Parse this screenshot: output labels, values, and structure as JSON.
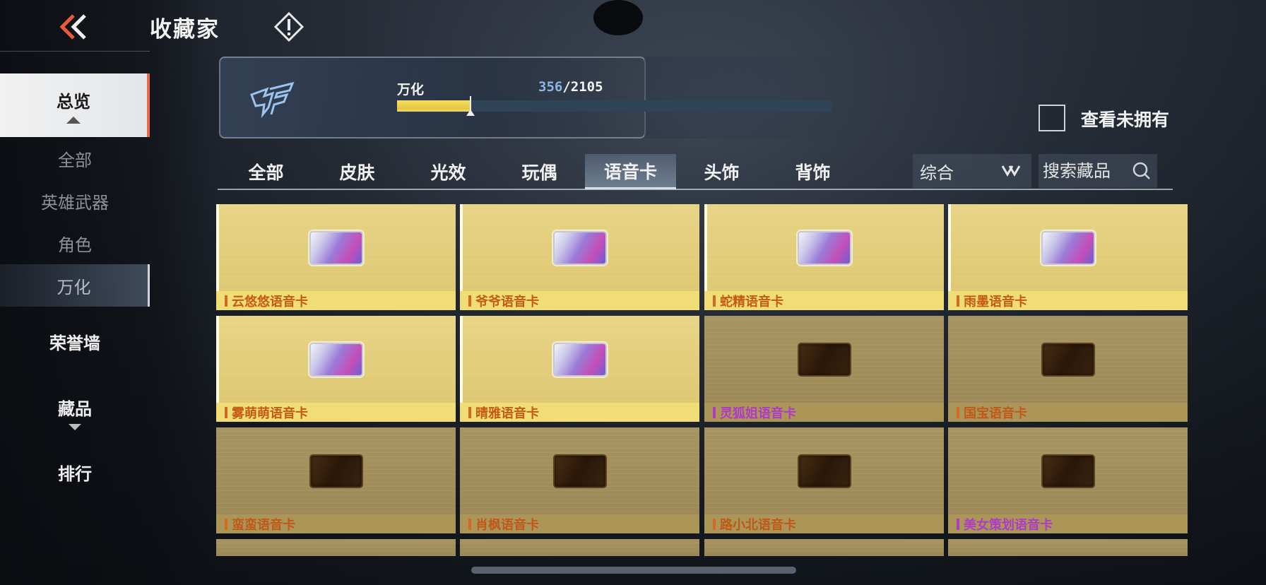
{
  "header": {
    "title": "收藏家",
    "back_icon": "double-chevron-left-icon",
    "info_icon": "exclamation-diamond-icon"
  },
  "sidebar": {
    "overview": "总览",
    "sub_items": [
      "全部",
      "英雄武器",
      "角色",
      "万化"
    ],
    "active_sub": "万化",
    "honor_wall": "荣誉墙",
    "collection": "藏品",
    "ranking": "排行"
  },
  "progress": {
    "label": "万化",
    "current": "356",
    "total": "/2105",
    "fraction": 0.169
  },
  "filter": {
    "unowned_label": "查看未拥有",
    "unowned_checked": false
  },
  "tabs": [
    "全部",
    "皮肤",
    "光效",
    "玩偶",
    "语音卡",
    "头饰",
    "背饰"
  ],
  "active_tab": "语音卡",
  "sort": {
    "value": "综合"
  },
  "search": {
    "placeholder": "搜索藏品"
  },
  "items": [
    {
      "name": "云悠悠语音卡",
      "owned": true,
      "rarity": "orange"
    },
    {
      "name": "爷爷语音卡",
      "owned": true,
      "rarity": "orange"
    },
    {
      "name": "蛇精语音卡",
      "owned": true,
      "rarity": "orange"
    },
    {
      "name": "雨墨语音卡",
      "owned": true,
      "rarity": "orange"
    },
    {
      "name": "雾萌萌语音卡",
      "owned": true,
      "rarity": "orange"
    },
    {
      "name": "晴雅语音卡",
      "owned": true,
      "rarity": "orange"
    },
    {
      "name": "灵狐姐语音卡",
      "owned": false,
      "rarity": "purple"
    },
    {
      "name": "国宝语音卡",
      "owned": false,
      "rarity": "orange"
    },
    {
      "name": "蛮蛮语音卡",
      "owned": false,
      "rarity": "orange"
    },
    {
      "name": "肖枫语音卡",
      "owned": false,
      "rarity": "orange"
    },
    {
      "name": "路小北语音卡",
      "owned": false,
      "rarity": "orange"
    },
    {
      "name": "美女策划语音卡",
      "owned": false,
      "rarity": "purple"
    }
  ],
  "colors": {
    "gold_card": "#e7d485",
    "locked_card": "#a89460",
    "orange_text": "#c45a14",
    "purple_text": "#b03ac8",
    "progress_fill": "#f4dc5e"
  }
}
